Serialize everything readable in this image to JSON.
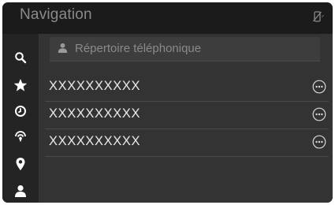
{
  "header": {
    "title": "Navigation"
  },
  "status": {
    "icon": "phone-no-signal-icon"
  },
  "sidebar": {
    "items": [
      {
        "icon": "search-icon"
      },
      {
        "icon": "star-icon"
      },
      {
        "icon": "clock-icon"
      },
      {
        "icon": "signal-location-icon"
      },
      {
        "icon": "map-pin-icon"
      },
      {
        "icon": "person-icon"
      }
    ]
  },
  "search": {
    "icon": "person-icon",
    "placeholder": "Répertoire téléphonique"
  },
  "list": {
    "rows": [
      {
        "name": "XXXXXXXXXX",
        "action_icon": "more-options-icon"
      },
      {
        "name": "XXXXXXXXXX",
        "action_icon": "more-options-icon"
      },
      {
        "name": "XXXXXXXXXX",
        "action_icon": "more-options-icon"
      }
    ]
  },
  "colors": {
    "background": "#1b1b1b",
    "sidebar": "#242424",
    "content": "#333333",
    "text": "#e8e8e8",
    "muted_text": "#8a8a8a"
  }
}
